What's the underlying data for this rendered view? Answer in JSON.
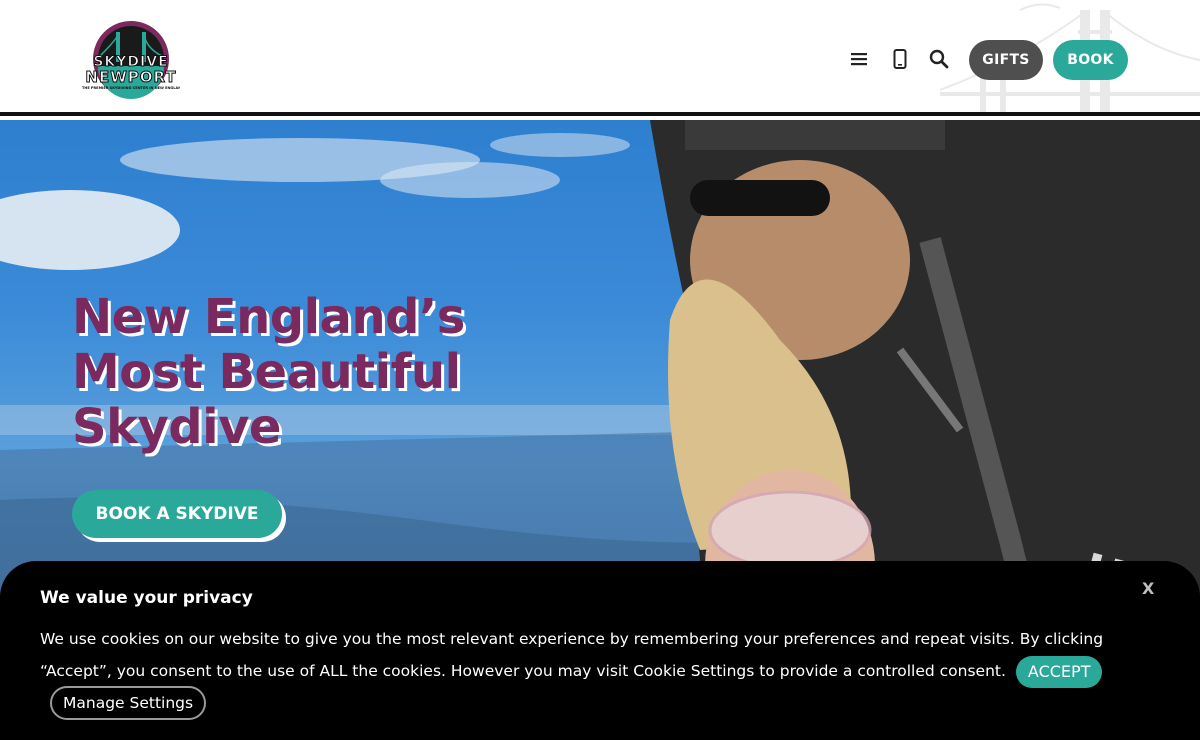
{
  "header": {
    "logo": {
      "line1": "SKYDIVE",
      "line2": "NEWPORT",
      "tagline": "THE PREMIER SKYDIVING CENTER IN NEW ENGLAND"
    },
    "icons": [
      "menu-icon",
      "phone-icon",
      "search-icon"
    ],
    "gifts_label": "GIFTS",
    "book_label": "BOOK"
  },
  "hero": {
    "title_line1": "New England’s",
    "title_line2": "Most Beautiful",
    "title_line3": "Skydive",
    "cta_label": "BOOK A SKYDIVE"
  },
  "cookie": {
    "close_label": "X",
    "title": "We value your privacy",
    "body": "We use cookies on our website to give you the most relevant experience by remembering your preferences and repeat visits. By clicking “Accept”, you consent to the use of ALL the cookies. However you may visit Cookie Settings to provide a controlled consent.",
    "accept_label": "ACCEPT",
    "manage_label": "Manage Settings"
  },
  "colors": {
    "brand_purple": "#7a2a5e",
    "brand_teal": "#2aa89a",
    "gifts_gray": "#4f4f4f",
    "banner_bg": "#000000"
  }
}
